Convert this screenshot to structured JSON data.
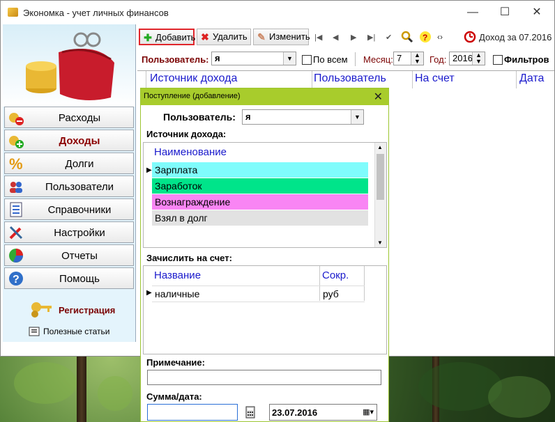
{
  "window": {
    "title": "Экономка - учет личных финансов"
  },
  "sidebar": {
    "items": [
      {
        "label": "Расходы"
      },
      {
        "label": "Доходы"
      },
      {
        "label": "Долги"
      },
      {
        "label": "Пользователи"
      },
      {
        "label": "Справочники"
      },
      {
        "label": "Настройки"
      },
      {
        "label": "Отчеты"
      },
      {
        "label": "Помощь"
      }
    ],
    "active": "Доходы",
    "registration": "Регистрация",
    "articles": "Полезные статьи"
  },
  "toolbar": {
    "add": "Добавить",
    "delete": "Удалить",
    "edit": "Изменить",
    "income_for": "Доход за 07.2016"
  },
  "filter": {
    "user_label": "Пользователь:",
    "user_value": "я",
    "all_label": "По всем",
    "month_label": "Месяц:",
    "month_value": "7",
    "year_label": "Год:",
    "year_value": "2016",
    "filter_label": "Фильтров"
  },
  "grid": {
    "columns": [
      "Источник дохода",
      "Пользователь",
      "На счет",
      "Дата"
    ]
  },
  "dialog": {
    "title": "Поступление (добавление)",
    "user_label": "Пользователь:",
    "user_value": "я",
    "source_label": "Источник дохода:",
    "source_header": "Наименование",
    "sources": [
      {
        "name": "Зарплата",
        "color": "#7ffcfc"
      },
      {
        "name": "Заработок",
        "color": "#00e48a"
      },
      {
        "name": "Вознаграждение",
        "color": "#f985f4"
      },
      {
        "name": "Взял в долг",
        "color": "#e2e2e2"
      }
    ],
    "account_label": "Зачислить на счет:",
    "account_headers": [
      "Название",
      "Сокр."
    ],
    "accounts": [
      {
        "name": "наличные",
        "short": "руб"
      }
    ],
    "note_label": "Примечание:",
    "amount_label": "Сумма/дата:",
    "date_value": "23.07.2016"
  },
  "colors": {
    "accent": "#a8cc2c",
    "header_blue": "#1a1acc",
    "label_red": "#7a0000"
  }
}
